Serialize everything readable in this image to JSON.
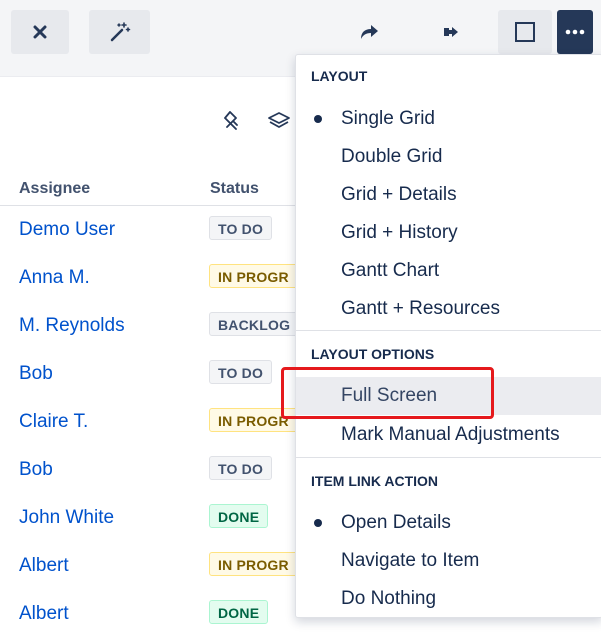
{
  "toolbar": {
    "close_icon": "close-icon",
    "magic_icon": "magic-wand-icon",
    "share_icon": "share-arrow-icon",
    "export_icon": "export-icon",
    "fullscreen_icon": "square-icon",
    "more_icon": "more-icon"
  },
  "grid": {
    "icons": [
      "pin-icon",
      "layers-icon"
    ],
    "columns": {
      "assignee": "Assignee",
      "status": "Status"
    },
    "rows": [
      {
        "assignee": "Demo User",
        "status": "TO DO"
      },
      {
        "assignee": "Anna M.",
        "status": "IN PROGR"
      },
      {
        "assignee": "M. Reynolds",
        "status": "BACKLOG"
      },
      {
        "assignee": "Bob",
        "status": "TO DO"
      },
      {
        "assignee": "Claire T.",
        "status": "IN PROGR"
      },
      {
        "assignee": "Bob",
        "status": "TO DO"
      },
      {
        "assignee": "John White",
        "status": "DONE"
      },
      {
        "assignee": "Albert",
        "status": "IN PROGR"
      },
      {
        "assignee": "Albert",
        "status": "DONE"
      }
    ]
  },
  "menu": {
    "layout_title": "LAYOUT",
    "layout_items": [
      "Single Grid",
      "Double Grid",
      "Grid + Details",
      "Grid + History",
      "Gantt Chart",
      "Gantt + Resources"
    ],
    "layout_selected": "Single Grid",
    "layout_options_title": "LAYOUT OPTIONS",
    "layout_options_items": [
      "Full Screen",
      "Mark Manual Adjustments"
    ],
    "item_link_title": "ITEM LINK ACTION",
    "item_link_items": [
      "Open Details",
      "Navigate to Item",
      "Do Nothing"
    ],
    "item_link_selected": "Open Details"
  },
  "colors": {
    "link": "#0052cc",
    "highlight": "#e5191c",
    "more_button_bg": "#253858"
  }
}
